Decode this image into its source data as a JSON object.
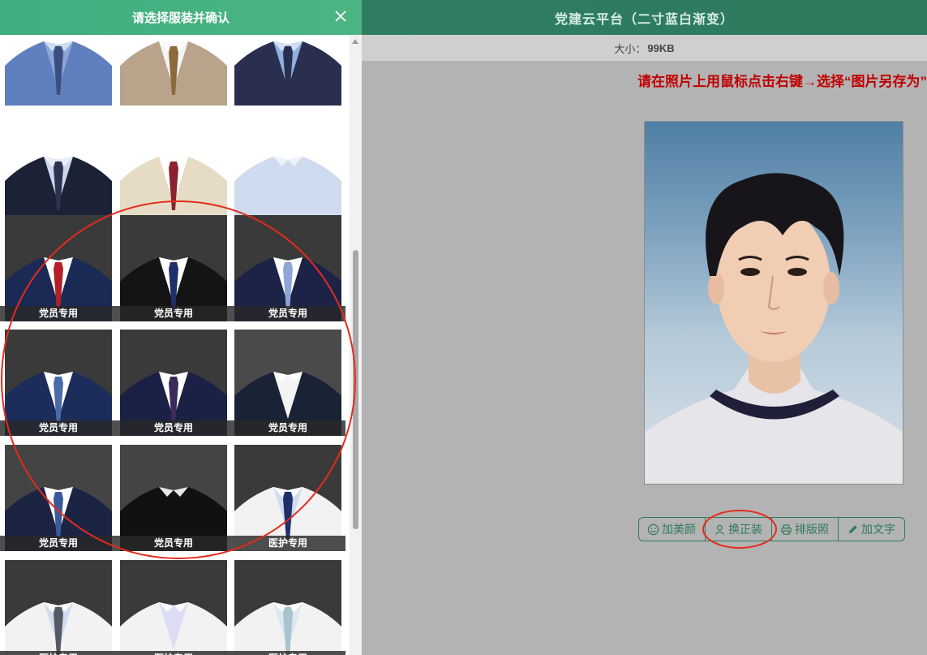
{
  "drawer": {
    "title": "请选择服装并确认",
    "close_icon": "close-icon",
    "tiles": [
      {
        "style": "blue-shirt-tie",
        "label": ""
      },
      {
        "style": "tan-suit",
        "label": ""
      },
      {
        "style": "navy-vest",
        "label": ""
      },
      {
        "style": "police-uniform",
        "label": ""
      },
      {
        "style": "beige-sweater",
        "label": ""
      },
      {
        "style": "light-blue-shirt",
        "label": ""
      },
      {
        "style": "navy-suit-red-tie",
        "label": "党员专用"
      },
      {
        "style": "black-suit-navy-tie",
        "label": "党员专用"
      },
      {
        "style": "navy-suit-light-tie",
        "label": "党员专用"
      },
      {
        "style": "navy-suit-stripe-tie",
        "label": "党员专用"
      },
      {
        "style": "navy-suit-dot-tie",
        "label": "党员专用"
      },
      {
        "style": "navy-jacket-open",
        "label": "党员专用"
      },
      {
        "style": "navy-suit-stripe2",
        "label": "党员专用"
      },
      {
        "style": "black-mao-suit",
        "label": "党员专用"
      },
      {
        "style": "white-coat-tie",
        "label": "医护专用"
      },
      {
        "style": "white-coat-grey-tie",
        "label": "医护专用"
      },
      {
        "style": "white-coat-plain",
        "label": "医护专用"
      },
      {
        "style": "white-coat-light-tie",
        "label": "医护专用"
      }
    ]
  },
  "header": {
    "title": "党建云平台（二寸蓝白渐变）"
  },
  "size_info": {
    "label": "大小：",
    "value": "99KB"
  },
  "save_hint": "请在照片上用鼠标点击右键→选择“图片另存为”",
  "actions": [
    {
      "label": "加美颜",
      "icon": "smile-icon"
    },
    {
      "label": "换正装",
      "icon": "user-icon"
    },
    {
      "label": "排版照",
      "icon": "printer-icon"
    },
    {
      "label": "加文字",
      "icon": "pencil-icon"
    }
  ],
  "colors": {
    "accent": "#2e7a5c",
    "drawer_header": "#45b080",
    "hint_red": "#c00000",
    "annotation_red": "#e32b1c"
  }
}
